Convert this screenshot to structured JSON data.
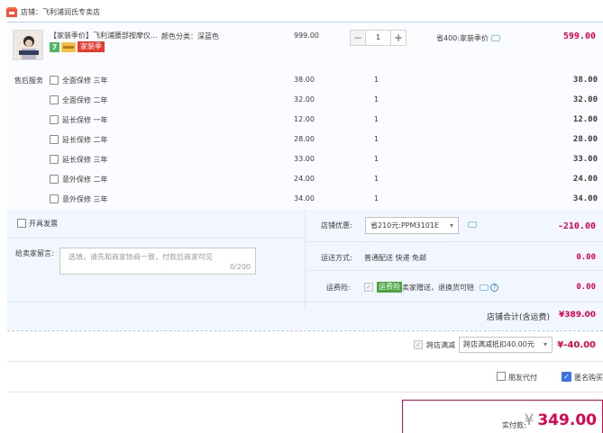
{
  "store": {
    "label": "店铺：飞利浦润氏专卖店"
  },
  "item": {
    "title": "【家装季价】飞利浦腰部按摩仪...",
    "color": "颜色分类：深蓝色",
    "badge_number": "7",
    "holiday_badge": "家装季",
    "price": "999.00",
    "quantity": "1",
    "minus": "−",
    "plus": "+",
    "promo": "省400:家装季价",
    "total": "599.00"
  },
  "after_sales": {
    "label": "售后服务",
    "services": [
      {
        "name": "全面保修  三年",
        "price": "38.00",
        "qty": "1",
        "total": "38.00"
      },
      {
        "name": "全面保修  二年",
        "price": "32.00",
        "qty": "1",
        "total": "32.00"
      },
      {
        "name": "延长保修  一年",
        "price": "12.00",
        "qty": "1",
        "total": "12.00"
      },
      {
        "name": "延长保修  二年",
        "price": "28.00",
        "qty": "1",
        "total": "28.00"
      },
      {
        "name": "延长保修  三年",
        "price": "33.00",
        "qty": "1",
        "total": "33.00"
      },
      {
        "name": "意外保修  二年",
        "price": "24.00",
        "qty": "1",
        "total": "24.00"
      },
      {
        "name": "意外保修  三年",
        "price": "34.00",
        "qty": "1",
        "total": "34.00"
      }
    ]
  },
  "invoice": {
    "label": "开具发票"
  },
  "message": {
    "label": "给卖家留言:",
    "placeholder": "选填，请先和商家协商一致，付款后商家可见",
    "count": "0/200"
  },
  "coupon": {
    "label": "店铺优惠:",
    "selected": "省210元:PPM3101E",
    "amount": "-210.00"
  },
  "shipping": {
    "label": "运送方式:",
    "value": "普通配送 快递 免邮",
    "amount": "0.00"
  },
  "insurance": {
    "label": "运费险:",
    "badge": "运费险",
    "text": "卖家赠送，退换货可赔",
    "amount": "0.00",
    "help": "?"
  },
  "store_total": {
    "label": "店铺合计(含运费)",
    "amount": "¥389.00"
  },
  "cross_store": {
    "label": "跨店满减",
    "selected": "跨店满减抵扣40.00元",
    "amount": "¥-40.00"
  },
  "options": {
    "friend_pay": "朋友代付",
    "anonymous": "匿名购买"
  },
  "payment": {
    "label": "实付款:",
    "currency": "¥",
    "amount": "349.00"
  },
  "icons": {
    "chevron": "▾",
    "check": "✓"
  },
  "colors": {
    "accent": "#e2004a",
    "link_blue": "#3a74e6"
  }
}
